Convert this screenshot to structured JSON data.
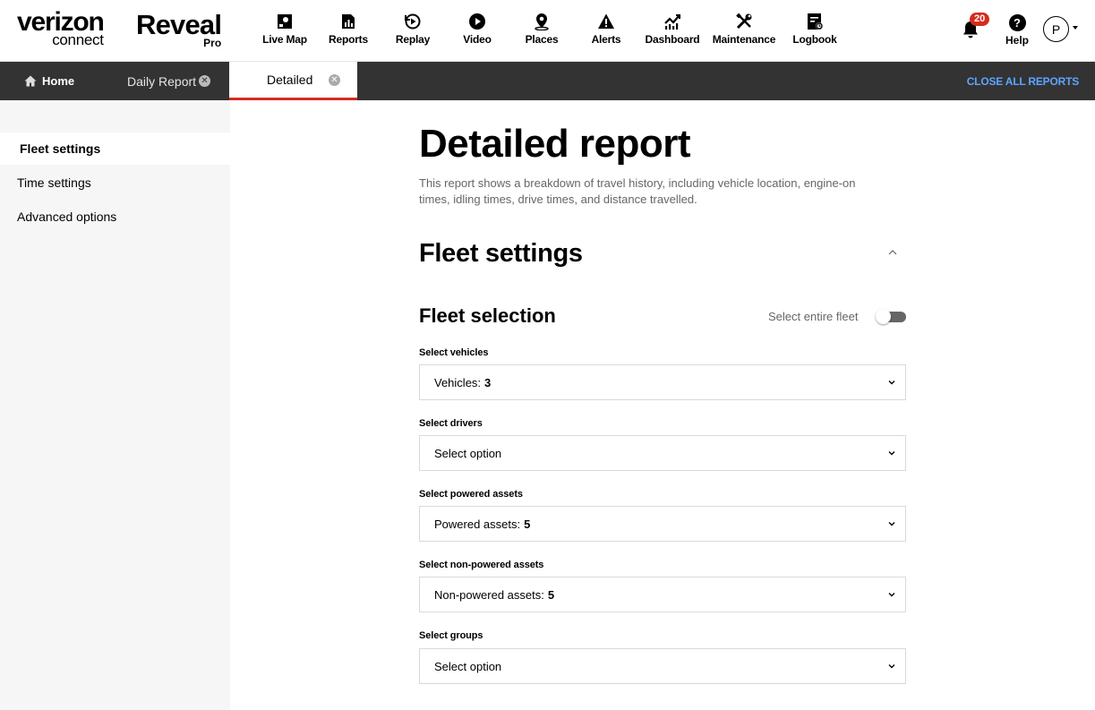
{
  "brand": {
    "company": "verizon",
    "company_sub": "connect",
    "product": "Reveal",
    "product_sub": "Pro"
  },
  "nav": [
    {
      "label": "Live Map",
      "icon": "map-pin-icon"
    },
    {
      "label": "Reports",
      "icon": "reports-icon"
    },
    {
      "label": "Replay",
      "icon": "replay-icon"
    },
    {
      "label": "Video",
      "icon": "play-icon"
    },
    {
      "label": "Places",
      "icon": "location-pin-icon"
    },
    {
      "label": "Alerts",
      "icon": "warning-icon"
    },
    {
      "label": "Dashboard",
      "icon": "dashboard-icon"
    },
    {
      "label": "Maintenance",
      "icon": "tools-icon"
    },
    {
      "label": "Logbook",
      "icon": "logbook-icon"
    }
  ],
  "notifications": {
    "count": "20",
    "icon": "bell-icon"
  },
  "help": {
    "label": "Help",
    "glyph": "?"
  },
  "user": {
    "initial": "P"
  },
  "tabs": {
    "home": "Home",
    "daily": "Daily Report",
    "active": "Detailed",
    "close_all": "CLOSE ALL REPORTS"
  },
  "sidebar": {
    "items": [
      {
        "label": "Fleet settings",
        "active": true
      },
      {
        "label": "Time settings",
        "active": false
      },
      {
        "label": "Advanced options",
        "active": false
      }
    ]
  },
  "main": {
    "title": "Detailed report",
    "description": "This report shows a breakdown of travel history, including vehicle location, engine-on times, idling times, drive times, and distance travelled.",
    "section_title": "Fleet settings",
    "subsection_title": "Fleet selection",
    "toggle_label": "Select entire fleet",
    "toggle_on": false,
    "fields": [
      {
        "label": "Select vehicles",
        "text": "Vehicles:",
        "value": "3"
      },
      {
        "label": "Select drivers",
        "text": "Select option",
        "value": ""
      },
      {
        "label": "Select powered assets",
        "text": "Powered assets:",
        "value": "5"
      },
      {
        "label": "Select non-powered assets",
        "text": "Non-powered assets:",
        "value": "5"
      },
      {
        "label": "Select groups",
        "text": "Select option",
        "value": ""
      }
    ]
  },
  "colors": {
    "accent_red": "#d52b1e",
    "tabbar": "#333333",
    "link_blue": "#5fa4ff",
    "sidebar_bg": "#f6f6f6"
  }
}
